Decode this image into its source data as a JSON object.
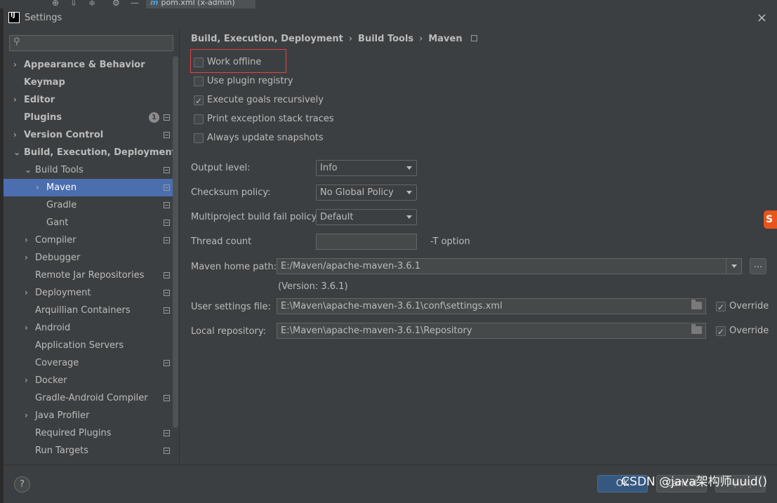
{
  "ide": {
    "tab_label": "pom.xml (x-admin)",
    "tab_icon_letter": "m"
  },
  "dialog": {
    "title": "Settings",
    "app_icon_text": "IJ"
  },
  "search": {
    "placeholder": ""
  },
  "sidebar": {
    "items": [
      {
        "label": "Appearance & Behavior",
        "bold": true,
        "level": 0,
        "chevron": "›",
        "proj": false,
        "badge": ""
      },
      {
        "label": "Keymap",
        "bold": true,
        "level": 0,
        "chevron": "",
        "proj": false,
        "badge": ""
      },
      {
        "label": "Editor",
        "bold": true,
        "level": 0,
        "chevron": "›",
        "proj": false,
        "badge": ""
      },
      {
        "label": "Plugins",
        "bold": true,
        "level": 0,
        "chevron": "",
        "proj": true,
        "badge": "1"
      },
      {
        "label": "Version Control",
        "bold": true,
        "level": 0,
        "chevron": "›",
        "proj": true,
        "badge": ""
      },
      {
        "label": "Build, Execution, Deployment",
        "bold": true,
        "level": 0,
        "chevron": "⌄",
        "proj": false,
        "badge": ""
      },
      {
        "label": "Build Tools",
        "bold": false,
        "level": 1,
        "chevron": "⌄",
        "proj": true,
        "badge": ""
      },
      {
        "label": "Maven",
        "bold": false,
        "level": 2,
        "chevron": "›",
        "proj": true,
        "badge": "",
        "selected": true
      },
      {
        "label": "Gradle",
        "bold": false,
        "level": 2,
        "chevron": "",
        "proj": true,
        "badge": ""
      },
      {
        "label": "Gant",
        "bold": false,
        "level": 2,
        "chevron": "",
        "proj": true,
        "badge": ""
      },
      {
        "label": "Compiler",
        "bold": false,
        "level": 1,
        "chevron": "›",
        "proj": true,
        "badge": ""
      },
      {
        "label": "Debugger",
        "bold": false,
        "level": 1,
        "chevron": "›",
        "proj": false,
        "badge": ""
      },
      {
        "label": "Remote Jar Repositories",
        "bold": false,
        "level": 1,
        "chevron": "",
        "proj": true,
        "badge": ""
      },
      {
        "label": "Deployment",
        "bold": false,
        "level": 1,
        "chevron": "›",
        "proj": true,
        "badge": ""
      },
      {
        "label": "Arquillian Containers",
        "bold": false,
        "level": 1,
        "chevron": "",
        "proj": true,
        "badge": ""
      },
      {
        "label": "Android",
        "bold": false,
        "level": 1,
        "chevron": "›",
        "proj": false,
        "badge": ""
      },
      {
        "label": "Application Servers",
        "bold": false,
        "level": 1,
        "chevron": "",
        "proj": false,
        "badge": ""
      },
      {
        "label": "Coverage",
        "bold": false,
        "level": 1,
        "chevron": "",
        "proj": true,
        "badge": ""
      },
      {
        "label": "Docker",
        "bold": false,
        "level": 1,
        "chevron": "›",
        "proj": false,
        "badge": ""
      },
      {
        "label": "Gradle-Android Compiler",
        "bold": false,
        "level": 1,
        "chevron": "",
        "proj": true,
        "badge": ""
      },
      {
        "label": "Java Profiler",
        "bold": false,
        "level": 1,
        "chevron": "›",
        "proj": false,
        "badge": ""
      },
      {
        "label": "Required Plugins",
        "bold": false,
        "level": 1,
        "chevron": "",
        "proj": true,
        "badge": ""
      },
      {
        "label": "Run Targets",
        "bold": false,
        "level": 1,
        "chevron": "",
        "proj": true,
        "badge": ""
      }
    ]
  },
  "breadcrumb": {
    "parts": [
      "Build, Execution, Deployment",
      "Build Tools",
      "Maven"
    ],
    "separator": "›"
  },
  "checkboxes": [
    {
      "label": "Work offline",
      "checked": false
    },
    {
      "label": "Use plugin registry",
      "checked": false
    },
    {
      "label": "Execute goals recursively",
      "checked": true
    },
    {
      "label": "Print exception stack traces",
      "checked": false
    },
    {
      "label": "Always update snapshots",
      "checked": false
    }
  ],
  "form": {
    "output_level_label": "Output level:",
    "output_level_value": "Info",
    "checksum_label": "Checksum policy:",
    "checksum_value": "No Global Policy",
    "fail_policy_label": "Multiproject build fail policy:",
    "fail_policy_value": "Default",
    "thread_count_label": "Thread count",
    "thread_count_value": "",
    "t_option": "-T option",
    "home_label": "Maven home path:",
    "home_value": "E:/Maven/apache-maven-3.6.1",
    "browse_label": "...",
    "version": "(Version: 3.6.1)",
    "settings_label": "User settings file:",
    "settings_value": "E:\\Maven\\apache-maven-3.6.1\\conf\\settings.xml",
    "settings_override": "Override",
    "repo_label": "Local repository:",
    "repo_value": "E:\\Maven\\apache-maven-3.6.1\\Repository",
    "repo_override": "Override"
  },
  "buttons": {
    "help": "?",
    "ok": "OK",
    "cancel": "Cancel",
    "apply": "Apply"
  },
  "watermark": "CSDN @java架构师uuid()",
  "sogou_letter": "S",
  "colors": {
    "background": "#3c3f41",
    "selection": "#4b6eaf",
    "highlight_box": "#e04444",
    "primary_button": "#365880"
  }
}
